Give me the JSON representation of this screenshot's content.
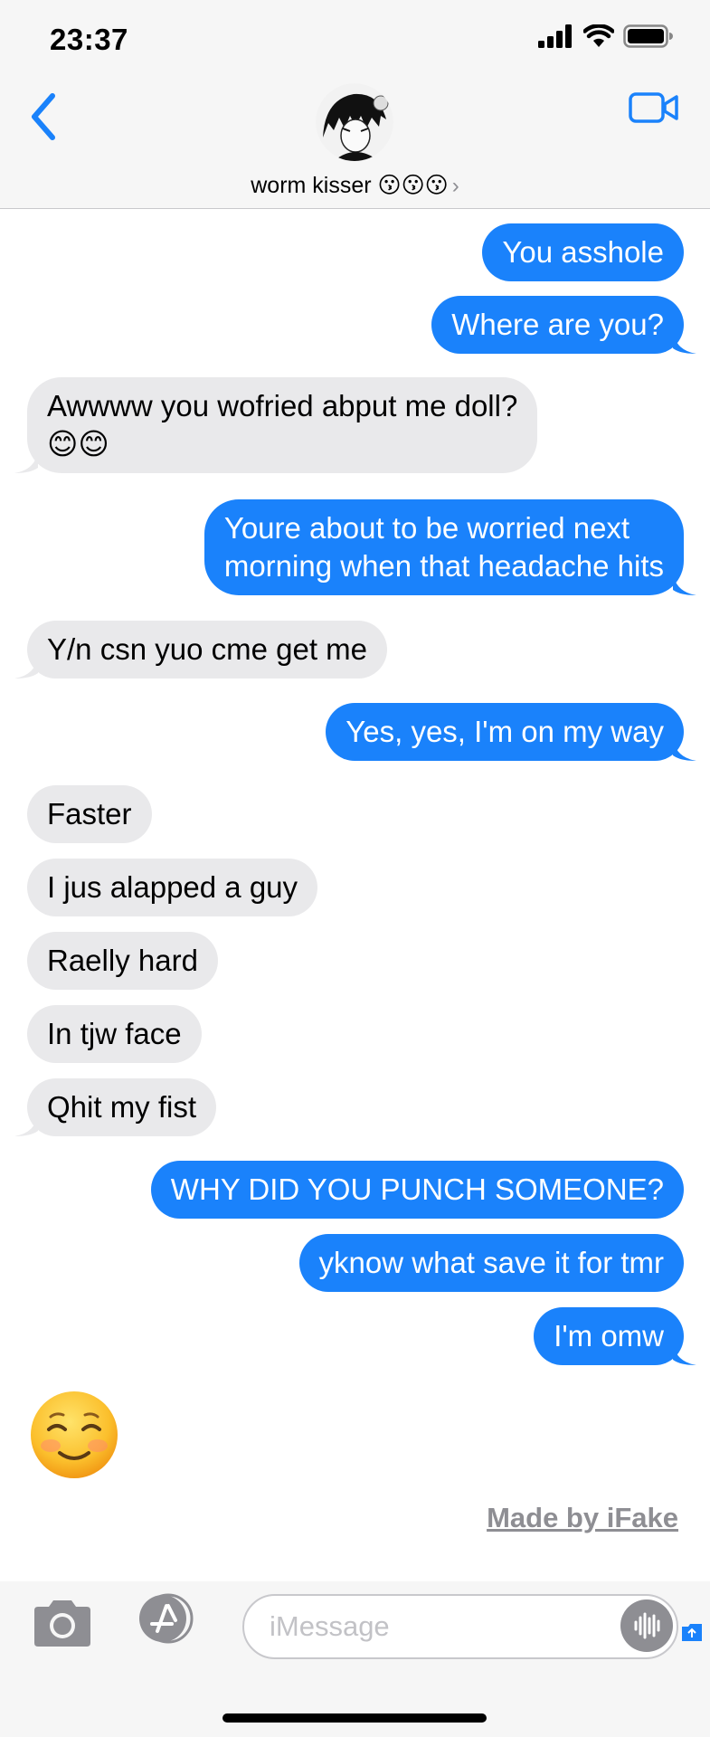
{
  "status": {
    "time": "23:37"
  },
  "header": {
    "contact_name": "worm kisser 😗😗😗",
    "chevron": "›"
  },
  "messages": [
    {
      "dir": "out",
      "text": "You asshole"
    },
    {
      "dir": "out",
      "text": "Where are you?"
    },
    {
      "dir": "in",
      "lines": [
        "Awwww you wofried abput me doll?",
        "😊😊"
      ]
    },
    {
      "dir": "out",
      "lines": [
        "Youre about to be worried next",
        "morning when that headache hits"
      ]
    },
    {
      "dir": "in",
      "text": "Y/n csn yuo cme get me"
    },
    {
      "dir": "out",
      "text": "Yes, yes, I'm on my way"
    },
    {
      "dir": "in",
      "text": "Faster"
    },
    {
      "dir": "in",
      "text": "I jus alapped a guy"
    },
    {
      "dir": "in",
      "text": "Raelly hard"
    },
    {
      "dir": "in",
      "text": "In tjw face"
    },
    {
      "dir": "in",
      "text": "Qhit my fist"
    },
    {
      "dir": "out",
      "text": "WHY DID YOU PUNCH SOMEONE?"
    },
    {
      "dir": "out",
      "text": "yknow what save it for tmr"
    },
    {
      "dir": "out",
      "text": "I'm omw"
    }
  ],
  "big_emoji": "☺️",
  "watermark": "Made by iFake",
  "composer": {
    "placeholder": "iMessage"
  },
  "colors": {
    "outgoing": "#1a82fb",
    "incoming": "#e9e9eb",
    "accent": "#1a82fb"
  }
}
